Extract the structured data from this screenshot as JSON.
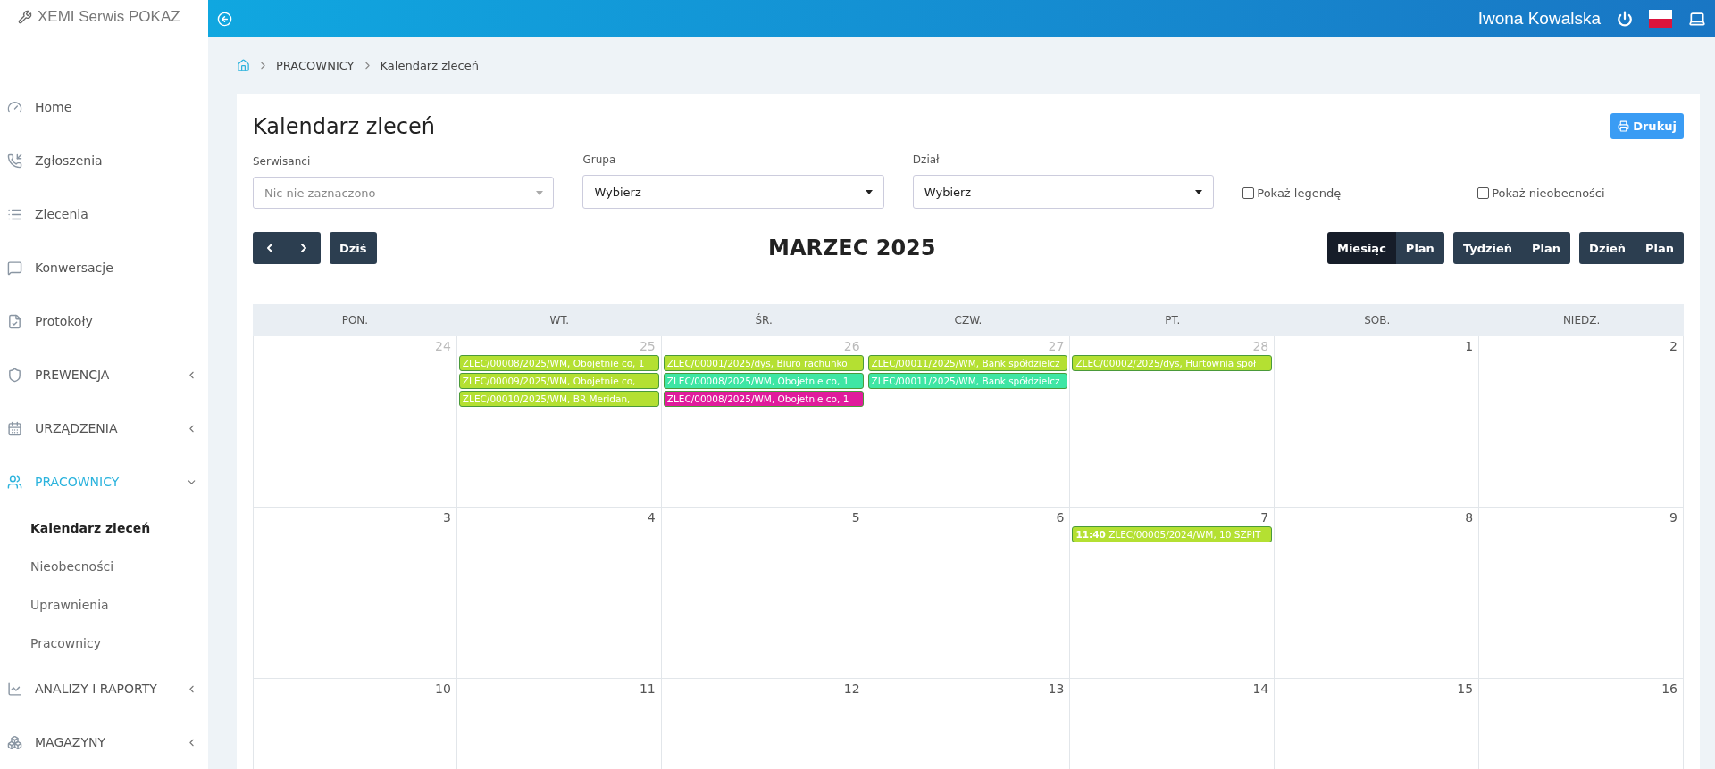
{
  "brand": "XEMI Serwis POKAZ",
  "user": {
    "name": "Iwona Kowalska"
  },
  "sidebar": {
    "items": [
      {
        "label": "Home",
        "selected": false
      },
      {
        "label": "Zgłoszenia",
        "selected": false
      },
      {
        "label": "Zlecenia",
        "selected": false
      },
      {
        "label": "Konwersacje",
        "selected": false
      },
      {
        "label": "Protokoły",
        "selected": false
      },
      {
        "label": "PREWENCJA",
        "expanded": false,
        "selected": false
      },
      {
        "label": "URZĄDZENIA",
        "expanded": false,
        "selected": false
      },
      {
        "label": "PRACOWNICY",
        "expanded": true,
        "selected": true,
        "children": [
          {
            "label": "Kalendarz zleceń",
            "selected": true
          },
          {
            "label": "Nieobecności",
            "selected": false
          },
          {
            "label": "Uprawnienia",
            "selected": false
          },
          {
            "label": "Pracownicy",
            "selected": false
          }
        ]
      },
      {
        "label": "ANALIZY I RAPORTY",
        "expanded": false,
        "selected": false
      },
      {
        "label": "MAGAZYNY",
        "expanded": false,
        "selected": false
      }
    ]
  },
  "breadcrumb": [
    "PRACOWNICY",
    "Kalendarz zleceń"
  ],
  "title": "Kalendarz zleceń",
  "print_button": "Drukuj",
  "filters": [
    {
      "label": "Serwisanci",
      "placeholder": "Nic nie zaznaczono"
    },
    {
      "label": "Grupa",
      "value": "Wybierz"
    },
    {
      "label": "Dział",
      "value": "Wybierz"
    }
  ],
  "checkboxes": [
    {
      "label": "Pokaż legendę",
      "checked": false
    },
    {
      "label": "Pokaż nieobecności",
      "checked": false
    }
  ],
  "today_button": "Dziś",
  "month_title": "MARZEC 2025",
  "view_groups": [
    [
      {
        "label": "Miesiąc",
        "selected": true
      },
      {
        "label": "Plan",
        "selected": false
      }
    ],
    [
      {
        "label": "Tydzień",
        "selected": false
      },
      {
        "label": "Plan",
        "selected": false
      }
    ],
    [
      {
        "label": "Dzień",
        "selected": false
      },
      {
        "label": "Plan",
        "selected": false
      }
    ]
  ],
  "weekdays": [
    "PON.",
    "WT.",
    "ŚR.",
    "CZW.",
    "PT.",
    "SOB.",
    "NIEDZ."
  ],
  "weeks": [
    [
      {
        "day": "24",
        "other_month": true
      },
      {
        "day": "25",
        "other_month": true,
        "events": [
          {
            "text": "ZLEC/00008/2025/WM, Obojetnie co, 1",
            "color": "#b4e032"
          },
          {
            "text": "ZLEC/00009/2025/WM, Obojetnie co,",
            "color": "#b4e032"
          },
          {
            "text": "ZLEC/00010/2025/WM, BR Meridan,",
            "color": "#b4e032"
          }
        ]
      },
      {
        "day": "26",
        "other_month": true,
        "events": [
          {
            "text": "ZLEC/00001/2025/dys, Biuro rachunko",
            "color": "#b4e032"
          },
          {
            "text": "ZLEC/00008/2025/WM, Obojetnie co, 1",
            "color": "#3ee6a4"
          },
          {
            "text": "ZLEC/00008/2025/WM, Obojetnie co, 1",
            "color": "#e01c9c"
          }
        ]
      },
      {
        "day": "27",
        "other_month": true,
        "events": [
          {
            "text": "ZLEC/00011/2025/WM, Bank spółdzielcz",
            "color": "#b4e032"
          },
          {
            "text": "ZLEC/00011/2025/WM, Bank spółdzielcz",
            "color": "#3ee6a4"
          }
        ]
      },
      {
        "day": "28",
        "other_month": true,
        "events": [
          {
            "text": "ZLEC/00002/2025/dys, Hurtownia społ",
            "color": "#b4e032"
          }
        ]
      },
      {
        "day": "1",
        "other_month": false
      },
      {
        "day": "2",
        "other_month": false
      }
    ],
    [
      {
        "day": "3",
        "other_month": false
      },
      {
        "day": "4",
        "other_month": false
      },
      {
        "day": "5",
        "other_month": false
      },
      {
        "day": "6",
        "other_month": false
      },
      {
        "day": "7",
        "other_month": false,
        "events": [
          {
            "text": "**11:40** ZLEC/00005/2024/WM, 10 SZPIT",
            "color": "#b4e032"
          }
        ]
      },
      {
        "day": "8",
        "other_month": false
      },
      {
        "day": "9",
        "other_month": false
      }
    ],
    [
      {
        "day": "10",
        "other_month": false
      },
      {
        "day": "11",
        "other_month": false
      },
      {
        "day": "12",
        "other_month": false
      },
      {
        "day": "13",
        "other_month": false
      },
      {
        "day": "14",
        "other_month": false
      },
      {
        "day": "15",
        "other_month": false
      },
      {
        "day": "16",
        "other_month": false
      }
    ]
  ]
}
